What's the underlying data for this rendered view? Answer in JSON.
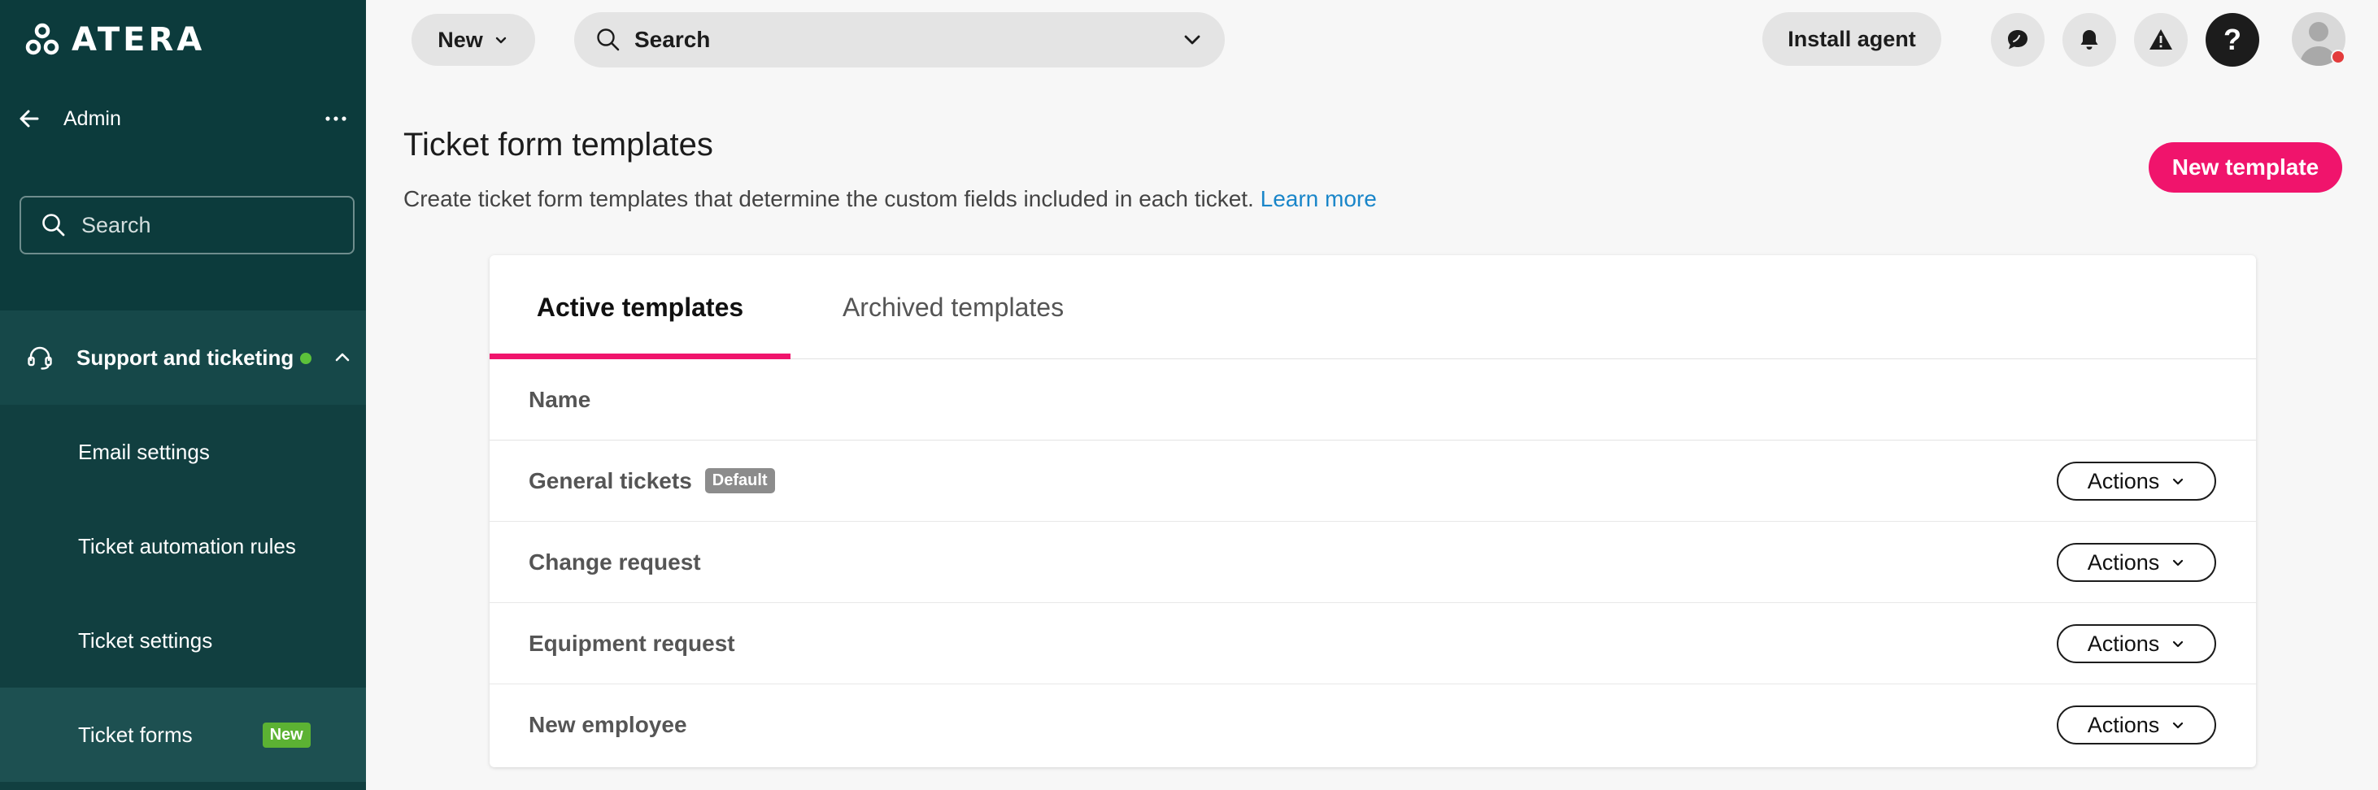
{
  "brand": {
    "logo_text": "ATERA"
  },
  "sidebar": {
    "back_label": "Admin",
    "search_placeholder": "Search",
    "section": {
      "title": "Support and ticketing",
      "status_color": "#5cc13a"
    },
    "items": [
      {
        "label": "Email settings"
      },
      {
        "label": "Ticket automation rules"
      },
      {
        "label": "Ticket settings"
      },
      {
        "label": "Ticket forms",
        "badge": "New",
        "active": true
      }
    ]
  },
  "topbar": {
    "new_label": "New",
    "search_placeholder": "Search",
    "install_label": "Install agent",
    "icons": [
      "chat-icon",
      "bell-icon",
      "alert-icon",
      "help-icon"
    ],
    "help_glyph": "?"
  },
  "header": {
    "title": "Ticket form templates",
    "description": "Create ticket form templates that determine the custom fields included in each ticket.",
    "learn_more": "Learn more",
    "new_template_label": "New template"
  },
  "tabs": [
    {
      "label": "Active templates",
      "active": true
    },
    {
      "label": "Archived templates",
      "active": false
    }
  ],
  "table": {
    "column_name": "Name",
    "actions_label": "Actions",
    "rows": [
      {
        "name": "General tickets",
        "badge": "Default"
      },
      {
        "name": "Change request"
      },
      {
        "name": "Equipment request"
      },
      {
        "name": "New employee"
      }
    ]
  },
  "colors": {
    "sidebar_bg": "#0c3b3c",
    "accent_pink": "#f0146c",
    "link_blue": "#1a86c9",
    "badge_green": "#5cb233"
  }
}
